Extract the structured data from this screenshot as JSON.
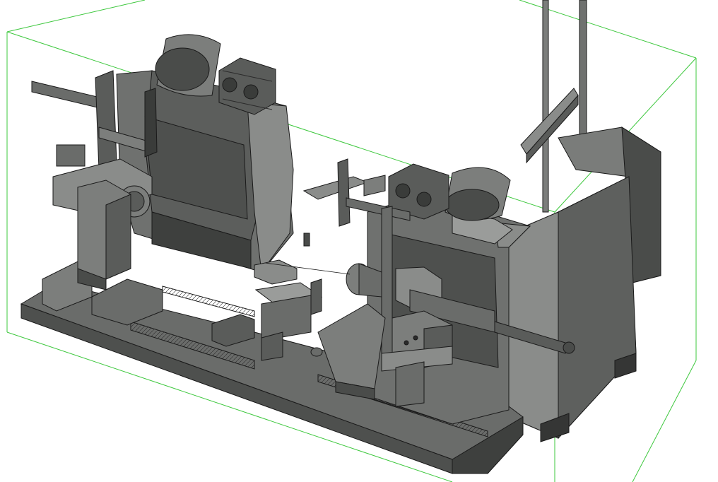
{
  "viewport": {
    "background": "#ffffff",
    "bounding_box_color": "#3ec83e",
    "line_color": "#1a1a1a"
  },
  "model": {
    "shade_light": "#9a9c9a",
    "shade_mid": "#6f716f",
    "shade_dark": "#4a4c4a",
    "shade_darker": "#353635",
    "components": [
      "base-rail",
      "left-welding-positioner",
      "right-welding-positioner",
      "left-wire-feeder",
      "right-wire-feeder",
      "left-wire-spool",
      "right-wire-spool",
      "left-torch-arm",
      "right-torch-arm",
      "tailstock-cylinder",
      "center-fixture",
      "control-cabinet",
      "vertical-mast"
    ]
  }
}
